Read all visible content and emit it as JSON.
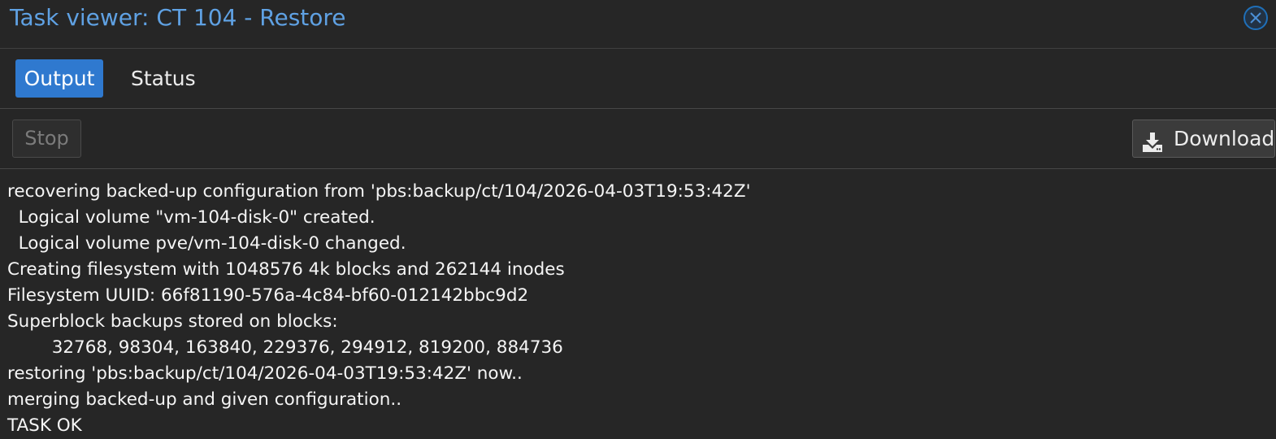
{
  "window": {
    "title": "Task viewer: CT 104 - Restore",
    "close_icon": "close-circle-icon"
  },
  "tabs": [
    {
      "label": "Output",
      "active": true
    },
    {
      "label": "Status",
      "active": false
    }
  ],
  "toolbar": {
    "stop_label": "Stop",
    "stop_disabled": true,
    "download_label": "Download",
    "download_icon": "download-icon"
  },
  "log": [
    "recovering backed-up configuration from 'pbs:backup/ct/104/2026-04-03T19:53:42Z'",
    "  Logical volume \"vm-104-disk-0\" created.",
    "  Logical volume pve/vm-104-disk-0 changed.",
    "Creating filesystem with 1048576 4k blocks and 262144 inodes",
    "Filesystem UUID: 66f81190-576a-4c84-bf60-012142bbc9d2",
    "Superblock backups stored on blocks:",
    "\t32768, 98304, 163840, 229376, 294912, 819200, 884736",
    "restoring 'pbs:backup/ct/104/2026-04-03T19:53:42Z' now..",
    "merging backed-up and given configuration..",
    "TASK OK"
  ],
  "colors": {
    "background": "#262626",
    "accent": "#2f79cf",
    "title": "#5fa1e3"
  }
}
